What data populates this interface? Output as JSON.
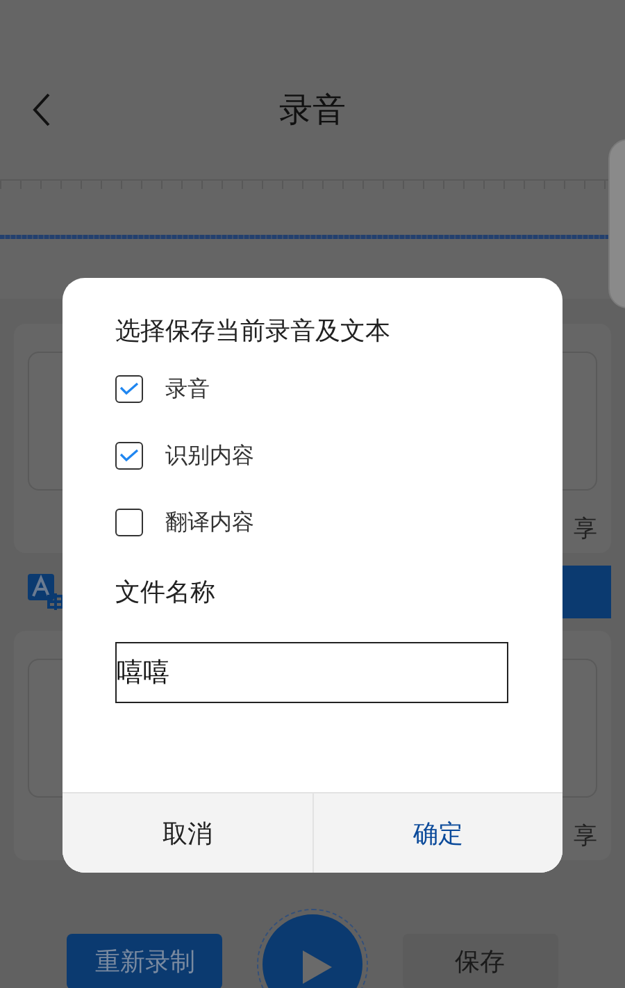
{
  "header": {
    "title": "录音"
  },
  "cards": [
    {
      "share_label": "享"
    },
    {
      "share_label": "享"
    }
  ],
  "bottom_bar": {
    "buttons": [
      {
        "kind": "primary",
        "label": "重新录制"
      },
      {
        "kind": "play"
      },
      {
        "kind": "secondary",
        "label": "保存"
      }
    ]
  },
  "dialog": {
    "title": "选择保存当前录音及文本",
    "options": [
      {
        "label": "录音",
        "checked": true
      },
      {
        "label": "识别内容",
        "checked": true
      },
      {
        "label": "翻译内容",
        "checked": false
      }
    ],
    "filename_label": "文件名称",
    "filename": {
      "value": "嘻嘻"
    },
    "buttons": [
      {
        "kind": "cancel",
        "label": "取消"
      },
      {
        "kind": "confirm",
        "label": "确定"
      }
    ]
  }
}
